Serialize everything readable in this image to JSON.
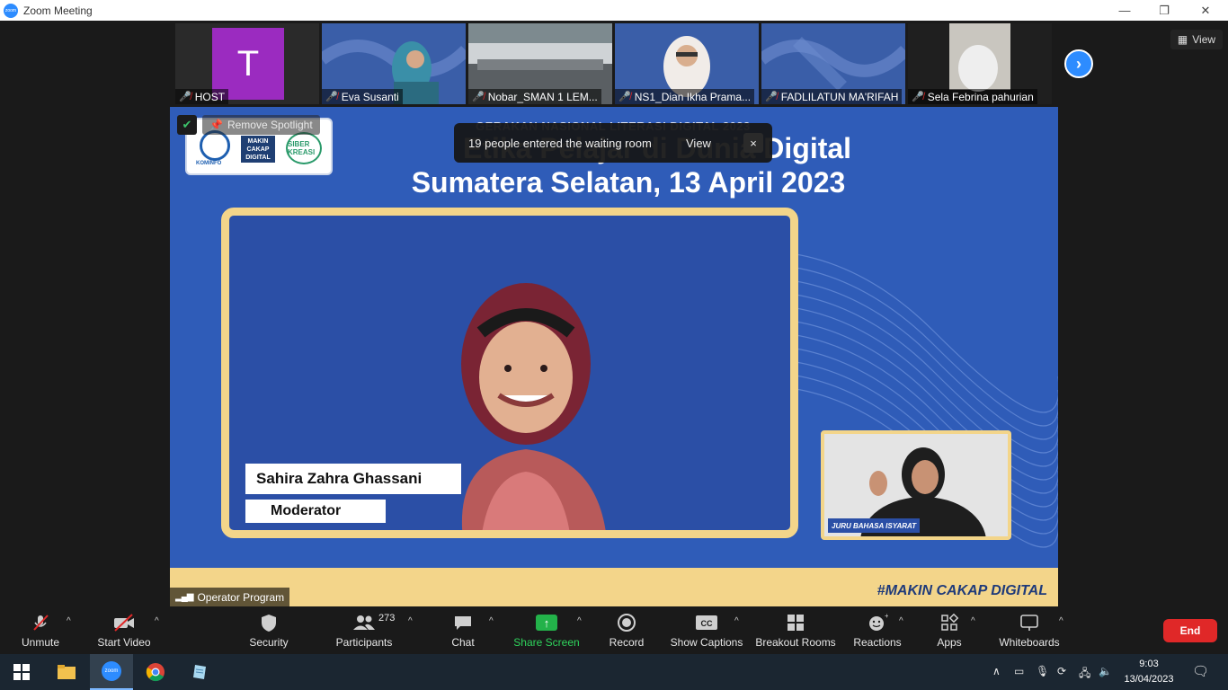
{
  "window": {
    "title": "Zoom Meeting",
    "minimize": "—",
    "restore": "❐",
    "close": "✕"
  },
  "thumbnails": [
    {
      "name": "HOST",
      "avatar_letter": "T",
      "muted": true
    },
    {
      "name": "Eva Susanti",
      "muted": true
    },
    {
      "name": "Nobar_SMAN 1 LEM...",
      "muted": true
    },
    {
      "name": "NS1_Dian Ikha Prama...",
      "muted": true
    },
    {
      "name": "FADLILATUN MA'RIFAH",
      "muted": true
    },
    {
      "name": "Sela Febrina pahurian",
      "muted": true
    }
  ],
  "view_button": "View",
  "stage": {
    "remove_spotlight": "Remove Spotlight",
    "eyebrow": "GERAKAN NASIONAL LITERASI DIGITAL 2023",
    "title_line1": "Etika Pelajar di Dunia Digital",
    "title_line2": "Sumatera Selatan, 13 April 2023",
    "speaker_name": "Sahira Zahra Ghassani",
    "speaker_role": "Moderator",
    "interpreter_label": "JURU BAHASA ISYARAT",
    "hashtag": "#MAKIN CAKAP DIGITAL",
    "operator": "Operator Program",
    "logos": {
      "kominfo": "KOMINFO",
      "makin_cakap": "MAKIN CAKAP DIGITAL",
      "siberkreasi": "SIBER KREASI"
    }
  },
  "toast": {
    "message": "19 people entered the waiting room",
    "view": "View",
    "close": "×"
  },
  "toolbar": {
    "unmute": "Unmute",
    "start_video": "Start Video",
    "security": "Security",
    "participants": "Participants",
    "participants_count": "273",
    "chat": "Chat",
    "share_screen": "Share Screen",
    "record": "Record",
    "show_captions": "Show Captions",
    "breakout_rooms": "Breakout Rooms",
    "reactions": "Reactions",
    "apps": "Apps",
    "whiteboards": "Whiteboards",
    "end": "End"
  },
  "taskbar": {
    "time": "9:03",
    "date": "13/04/2023"
  }
}
